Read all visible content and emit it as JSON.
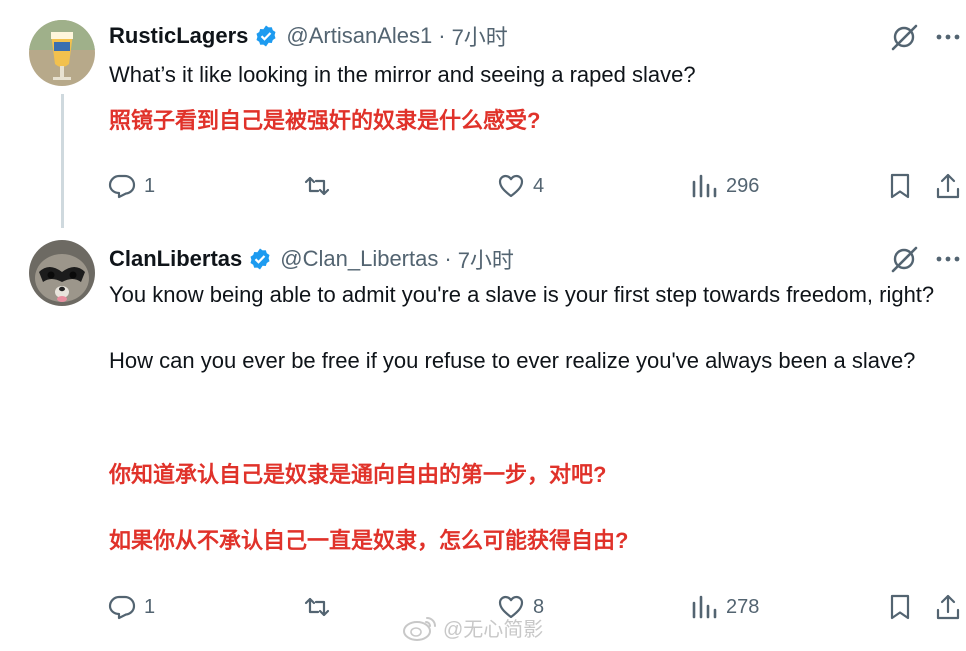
{
  "tweets": [
    {
      "name": "RusticLagers",
      "handle": "@ArtisanAles1",
      "dot": "·",
      "time": "7小时",
      "text_en": "What’s it like looking in the mirror and seeing a raped slave?",
      "text_zh": "照镜子看到自己是被强奸的奴隶是什么感受?",
      "replies": "1",
      "retweets": "",
      "likes": "4",
      "views": "296"
    },
    {
      "name": "ClanLibertas",
      "handle": "@Clan_Libertas",
      "dot": "·",
      "time": "7小时",
      "text_en": "You know being able to admit you're a slave is your first step towards freedom, right?\n\nHow can you ever be free if you refuse to ever realize you've always been a slave?",
      "text_zh": "你知道承认自己是奴隶是通向自由的第一步，对吧?\n\n如果你从不承认自己一直是奴隶，怎么可能获得自由?",
      "replies": "1",
      "retweets": "",
      "likes": "8",
      "views": "278"
    }
  ],
  "watermark": "@无心简影",
  "colors": {
    "verified": "#1d9bf0",
    "translation": "#e0322a",
    "muted": "#536471"
  },
  "icons": [
    "verified-badge-icon",
    "grok-icon",
    "more-icon",
    "reply-icon",
    "retweet-icon",
    "like-icon",
    "views-icon",
    "bookmark-icon",
    "share-icon",
    "weibo-icon"
  ]
}
